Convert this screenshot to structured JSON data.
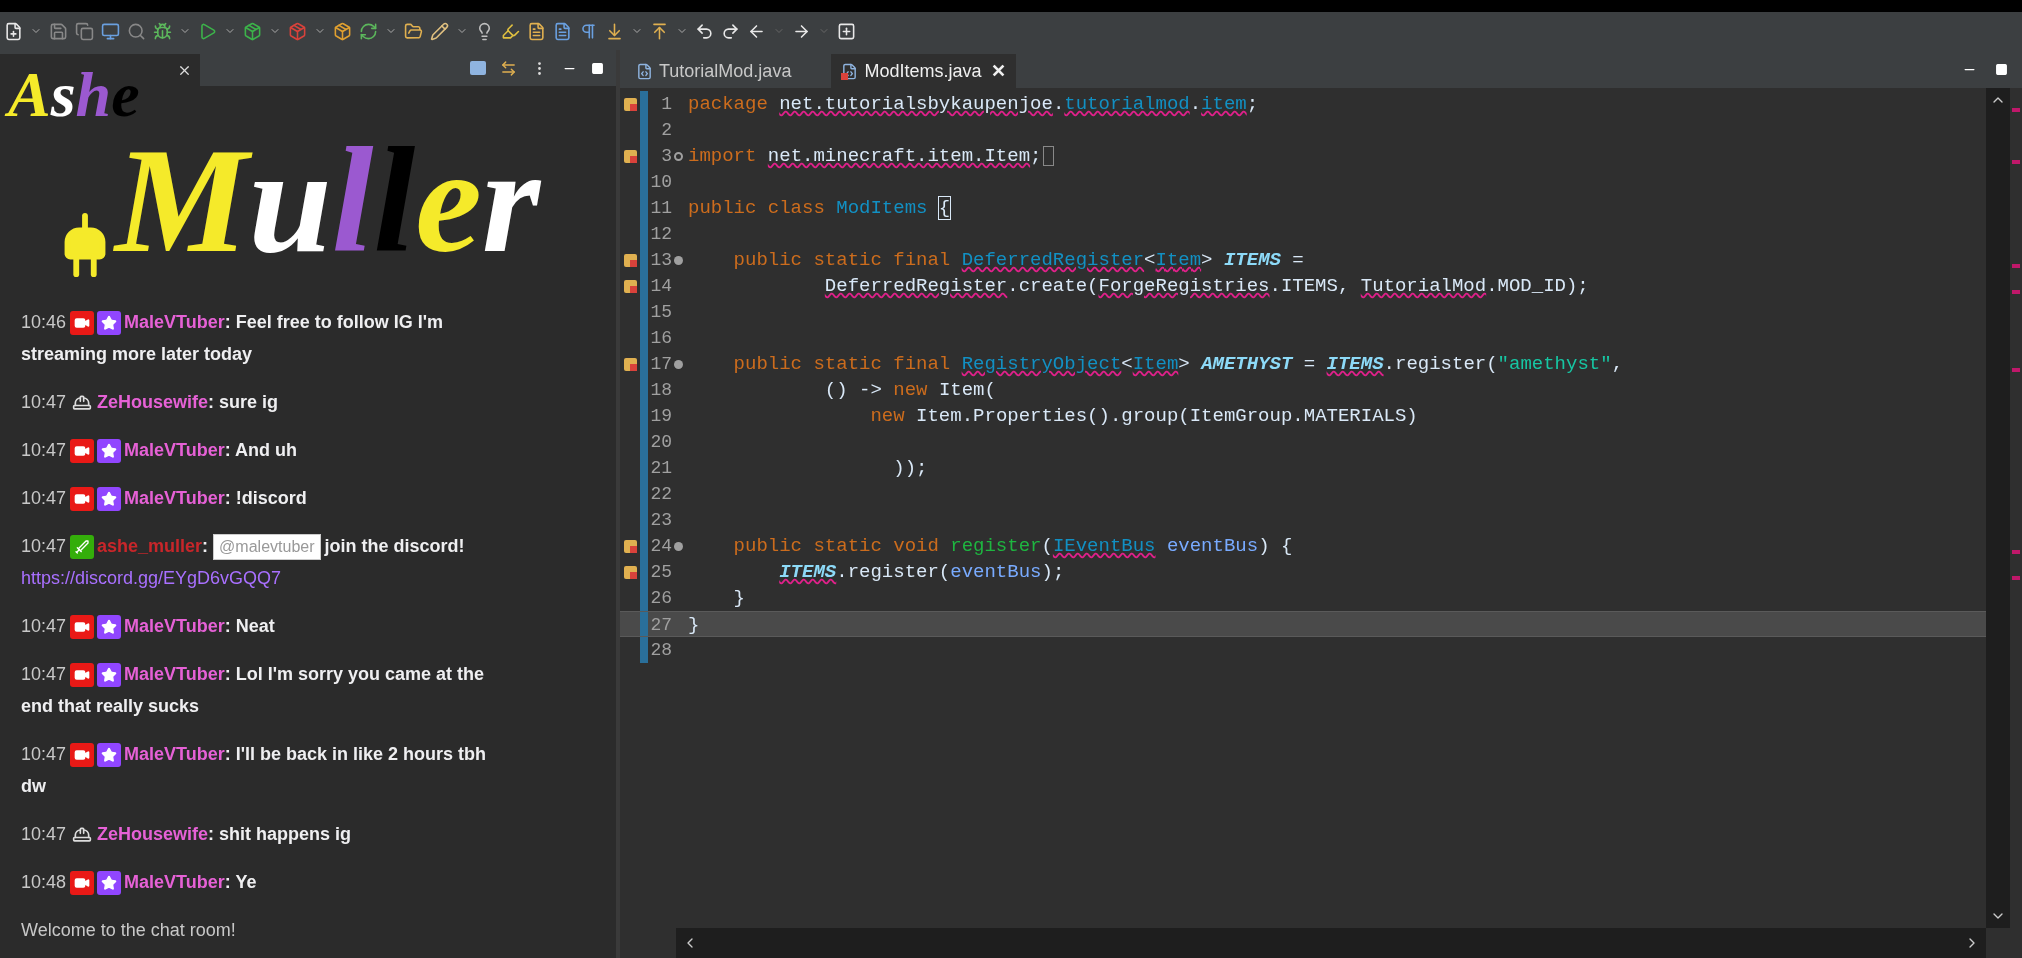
{
  "overlay_logo": {
    "lines": [
      {
        "letters": [
          {
            "char": "A",
            "color": "#f5ea2a"
          },
          {
            "char": "s",
            "color": "#ffffff"
          },
          {
            "char": "h",
            "color": "#9b59d0"
          },
          {
            "char": "e",
            "color": "#000000"
          }
        ]
      },
      {
        "letters": [
          {
            "char": "M",
            "color": "#f5ea2a"
          },
          {
            "char": "u",
            "color": "#ffffff"
          },
          {
            "char": "l",
            "color": "#9b59d0"
          },
          {
            "char": "l",
            "color": "#000000"
          },
          {
            "char": "e",
            "color": "#f5ea2a"
          },
          {
            "char": "r",
            "color": "#ffffff"
          }
        ]
      }
    ]
  },
  "chat": {
    "messages": [
      {
        "time": "10:46",
        "badges": [
          {
            "kind": "video"
          },
          {
            "kind": "star"
          }
        ],
        "user": "MaleVTuber",
        "color": "#e661d6",
        "parts": [
          {
            "kind": "text",
            "text": ": Feel free to follow IG I'm"
          },
          {
            "kind": "line",
            "text": "streaming more later today"
          }
        ]
      },
      {
        "time": "10:47",
        "badges": [
          {
            "kind": "helmet"
          }
        ],
        "user": "ZeHousewife",
        "color": "#e661d6",
        "parts": [
          {
            "kind": "text",
            "text": ": sure ig"
          }
        ]
      },
      {
        "time": "10:47",
        "badges": [
          {
            "kind": "video"
          },
          {
            "kind": "star"
          }
        ],
        "user": "MaleVTuber",
        "color": "#e661d6",
        "parts": [
          {
            "kind": "text",
            "text": ": And uh"
          }
        ]
      },
      {
        "time": "10:47",
        "badges": [
          {
            "kind": "video"
          },
          {
            "kind": "star"
          }
        ],
        "user": "MaleVTuber",
        "color": "#e661d6",
        "parts": [
          {
            "kind": "text",
            "text": ": !discord"
          }
        ]
      },
      {
        "time": "10:47",
        "badges": [
          {
            "kind": "sword"
          }
        ],
        "user": "ashe_muller",
        "color": "#c8262a",
        "parts": [
          {
            "kind": "text",
            "text": ":"
          },
          {
            "kind": "mention",
            "text": "@malevtuber"
          },
          {
            "kind": "text",
            "text": "join the discord!"
          },
          {
            "kind": "link",
            "text": "https://discord.gg/EYgD6vGQQ7"
          }
        ]
      },
      {
        "time": "10:47",
        "badges": [
          {
            "kind": "video"
          },
          {
            "kind": "star"
          }
        ],
        "user": "MaleVTuber",
        "color": "#e661d6",
        "parts": [
          {
            "kind": "text",
            "text": ": Neat"
          }
        ]
      },
      {
        "time": "10:47",
        "badges": [
          {
            "kind": "video"
          },
          {
            "kind": "star"
          }
        ],
        "user": "MaleVTuber",
        "color": "#e661d6",
        "parts": [
          {
            "kind": "text",
            "text": ": Lol I'm sorry you came at the"
          },
          {
            "kind": "line",
            "text": "end that really sucks"
          }
        ]
      },
      {
        "time": "10:47",
        "badges": [
          {
            "kind": "video"
          },
          {
            "kind": "star"
          }
        ],
        "user": "MaleVTuber",
        "color": "#e661d6",
        "parts": [
          {
            "kind": "text",
            "text": ": I'll be back in like 2 hours tbh"
          },
          {
            "kind": "line",
            "text": "dw"
          }
        ]
      },
      {
        "time": "10:47",
        "badges": [
          {
            "kind": "helmet"
          }
        ],
        "user": "ZeHousewife",
        "color": "#e661d6",
        "parts": [
          {
            "kind": "text",
            "text": ": shit happens ig"
          }
        ]
      },
      {
        "time": "10:48",
        "badges": [
          {
            "kind": "video"
          },
          {
            "kind": "star"
          }
        ],
        "user": "MaleVTuber",
        "color": "#e661d6",
        "parts": [
          {
            "kind": "text",
            "text": ": Ye"
          }
        ]
      }
    ],
    "footer": "Welcome to the chat room!"
  },
  "editor": {
    "tabs": [
      {
        "label": "TutorialMod.java",
        "selected": false,
        "error": false
      },
      {
        "label": "ModItems.java",
        "selected": true,
        "error": true,
        "close": "✕"
      }
    ],
    "lines": [
      {
        "number": "1",
        "error": true,
        "current": false,
        "tokens": [
          {
            "kind": "kw",
            "t": "package "
          },
          {
            "kind": "plain",
            "t": "net.tutorialsbykaupenjoe",
            "err": true
          },
          {
            "kind": "plain",
            "t": "."
          },
          {
            "kind": "type",
            "t": "tutorialmod",
            "err": true
          },
          {
            "kind": "plain",
            "t": "."
          },
          {
            "kind": "type",
            "t": "item",
            "err": true
          },
          {
            "kind": "plain",
            "t": ";"
          }
        ]
      },
      {
        "number": "2",
        "error": false,
        "current": false
      },
      {
        "number": "3",
        "error": true,
        "fold_point": true,
        "collapsed": true,
        "folded_box": true,
        "current": false,
        "tokens": [
          {
            "kind": "kw",
            "t": "import "
          },
          {
            "kind": "plain",
            "t": "net.minecraft.item.Item",
            "err": true
          },
          {
            "kind": "plain",
            "t": ";"
          }
        ]
      },
      {
        "number": "10",
        "error": false,
        "current": false
      },
      {
        "number": "11",
        "error": false,
        "current": false,
        "tokens": [
          {
            "kind": "kw",
            "t": "public class "
          },
          {
            "kind": "type",
            "t": "ModItems"
          },
          {
            "kind": "brace",
            "t": "{"
          }
        ]
      },
      {
        "number": "12",
        "error": false,
        "current": false
      },
      {
        "number": "13",
        "error": true,
        "fold_point": true,
        "collapsed": false,
        "current": false,
        "tokens": [
          {
            "kind": "kw",
            "t": "    public static final "
          },
          {
            "kind": "type",
            "t": "DeferredRegister",
            "err": true
          },
          {
            "kind": "plain",
            "t": "<"
          },
          {
            "kind": "type",
            "t": "Item",
            "err": true
          },
          {
            "kind": "plain",
            "t": "> "
          },
          {
            "kind": "field",
            "t": "ITEMS"
          },
          {
            "kind": "plain",
            "t": " ="
          }
        ]
      },
      {
        "number": "14",
        "error": true,
        "current": false,
        "tokens": [
          {
            "kind": "plain",
            "t": "            DeferredRegister",
            "err": true
          },
          {
            "kind": "plain",
            "t": ".create("
          },
          {
            "kind": "plain",
            "t": "ForgeRegistries",
            "err": true
          },
          {
            "kind": "plain",
            "t": ".ITEMS, "
          },
          {
            "kind": "plain",
            "t": "TutorialMod",
            "err": true
          },
          {
            "kind": "plain",
            "t": ".MOD_ID);"
          }
        ]
      },
      {
        "number": "15",
        "error": false,
        "current": false
      },
      {
        "number": "16",
        "error": false,
        "current": false
      },
      {
        "number": "17",
        "error": true,
        "fold_point": true,
        "collapsed": false,
        "current": false,
        "tokens": [
          {
            "kind": "kw",
            "t": "    public static final "
          },
          {
            "kind": "type",
            "t": "RegistryObject",
            "err": true
          },
          {
            "kind": "plain",
            "t": "<"
          },
          {
            "kind": "type",
            "t": "Item",
            "err": true
          },
          {
            "kind": "plain",
            "t": "> "
          },
          {
            "kind": "field",
            "t": "AMETHYST"
          },
          {
            "kind": "plain",
            "t": " = "
          },
          {
            "kind": "field",
            "t": "ITEMS",
            "err": true
          },
          {
            "kind": "plain",
            "t": ".register("
          },
          {
            "kind": "string",
            "t": "\"amethyst\""
          },
          {
            "kind": "plain",
            "t": ","
          }
        ]
      },
      {
        "number": "18",
        "error": false,
        "current": false,
        "tokens": [
          {
            "kind": "plain",
            "t": "            () -> "
          },
          {
            "kind": "kw",
            "t": "new"
          },
          {
            "kind": "plain",
            "t": " Item("
          }
        ]
      },
      {
        "number": "19",
        "error": false,
        "current": false,
        "tokens": [
          {
            "kind": "kw",
            "t": "                new"
          },
          {
            "kind": "plain",
            "t": " Item.Properties().group(ItemGroup.MATERIALS)"
          }
        ]
      },
      {
        "number": "20",
        "error": false,
        "current": false
      },
      {
        "number": "21",
        "error": false,
        "current": false,
        "tokens": [
          {
            "kind": "plain",
            "t": "                  ));"
          }
        ]
      },
      {
        "number": "22",
        "error": false,
        "current": false
      },
      {
        "number": "23",
        "error": false,
        "current": false
      },
      {
        "number": "24",
        "error": true,
        "fold_point": true,
        "collapsed": false,
        "current": false,
        "tokens": [
          {
            "kind": "kw",
            "t": "    public static void "
          },
          {
            "kind": "method",
            "t": "register"
          },
          {
            "kind": "plain",
            "t": "("
          },
          {
            "kind": "type",
            "t": "IEventBus",
            "err": true
          },
          {
            "kind": "param",
            "t": " eventBus"
          },
          {
            "kind": "plain",
            "t": ") {"
          }
        ]
      },
      {
        "number": "25",
        "error": true,
        "current": false,
        "tokens": [
          {
            "kind": "field",
            "t": "        ITEMS",
            "err": true
          },
          {
            "kind": "plain",
            "t": ".register("
          },
          {
            "kind": "param",
            "t": "eventBus"
          },
          {
            "kind": "plain",
            "t": ");"
          }
        ]
      },
      {
        "number": "26",
        "error": false,
        "current": false,
        "tokens": [
          {
            "kind": "plain",
            "t": "    }"
          }
        ]
      },
      {
        "number": "27",
        "error": false,
        "current": true,
        "tokens": [
          {
            "kind": "plain",
            "t": "}"
          }
        ]
      },
      {
        "number": "28",
        "error": false,
        "current": false
      }
    ]
  }
}
